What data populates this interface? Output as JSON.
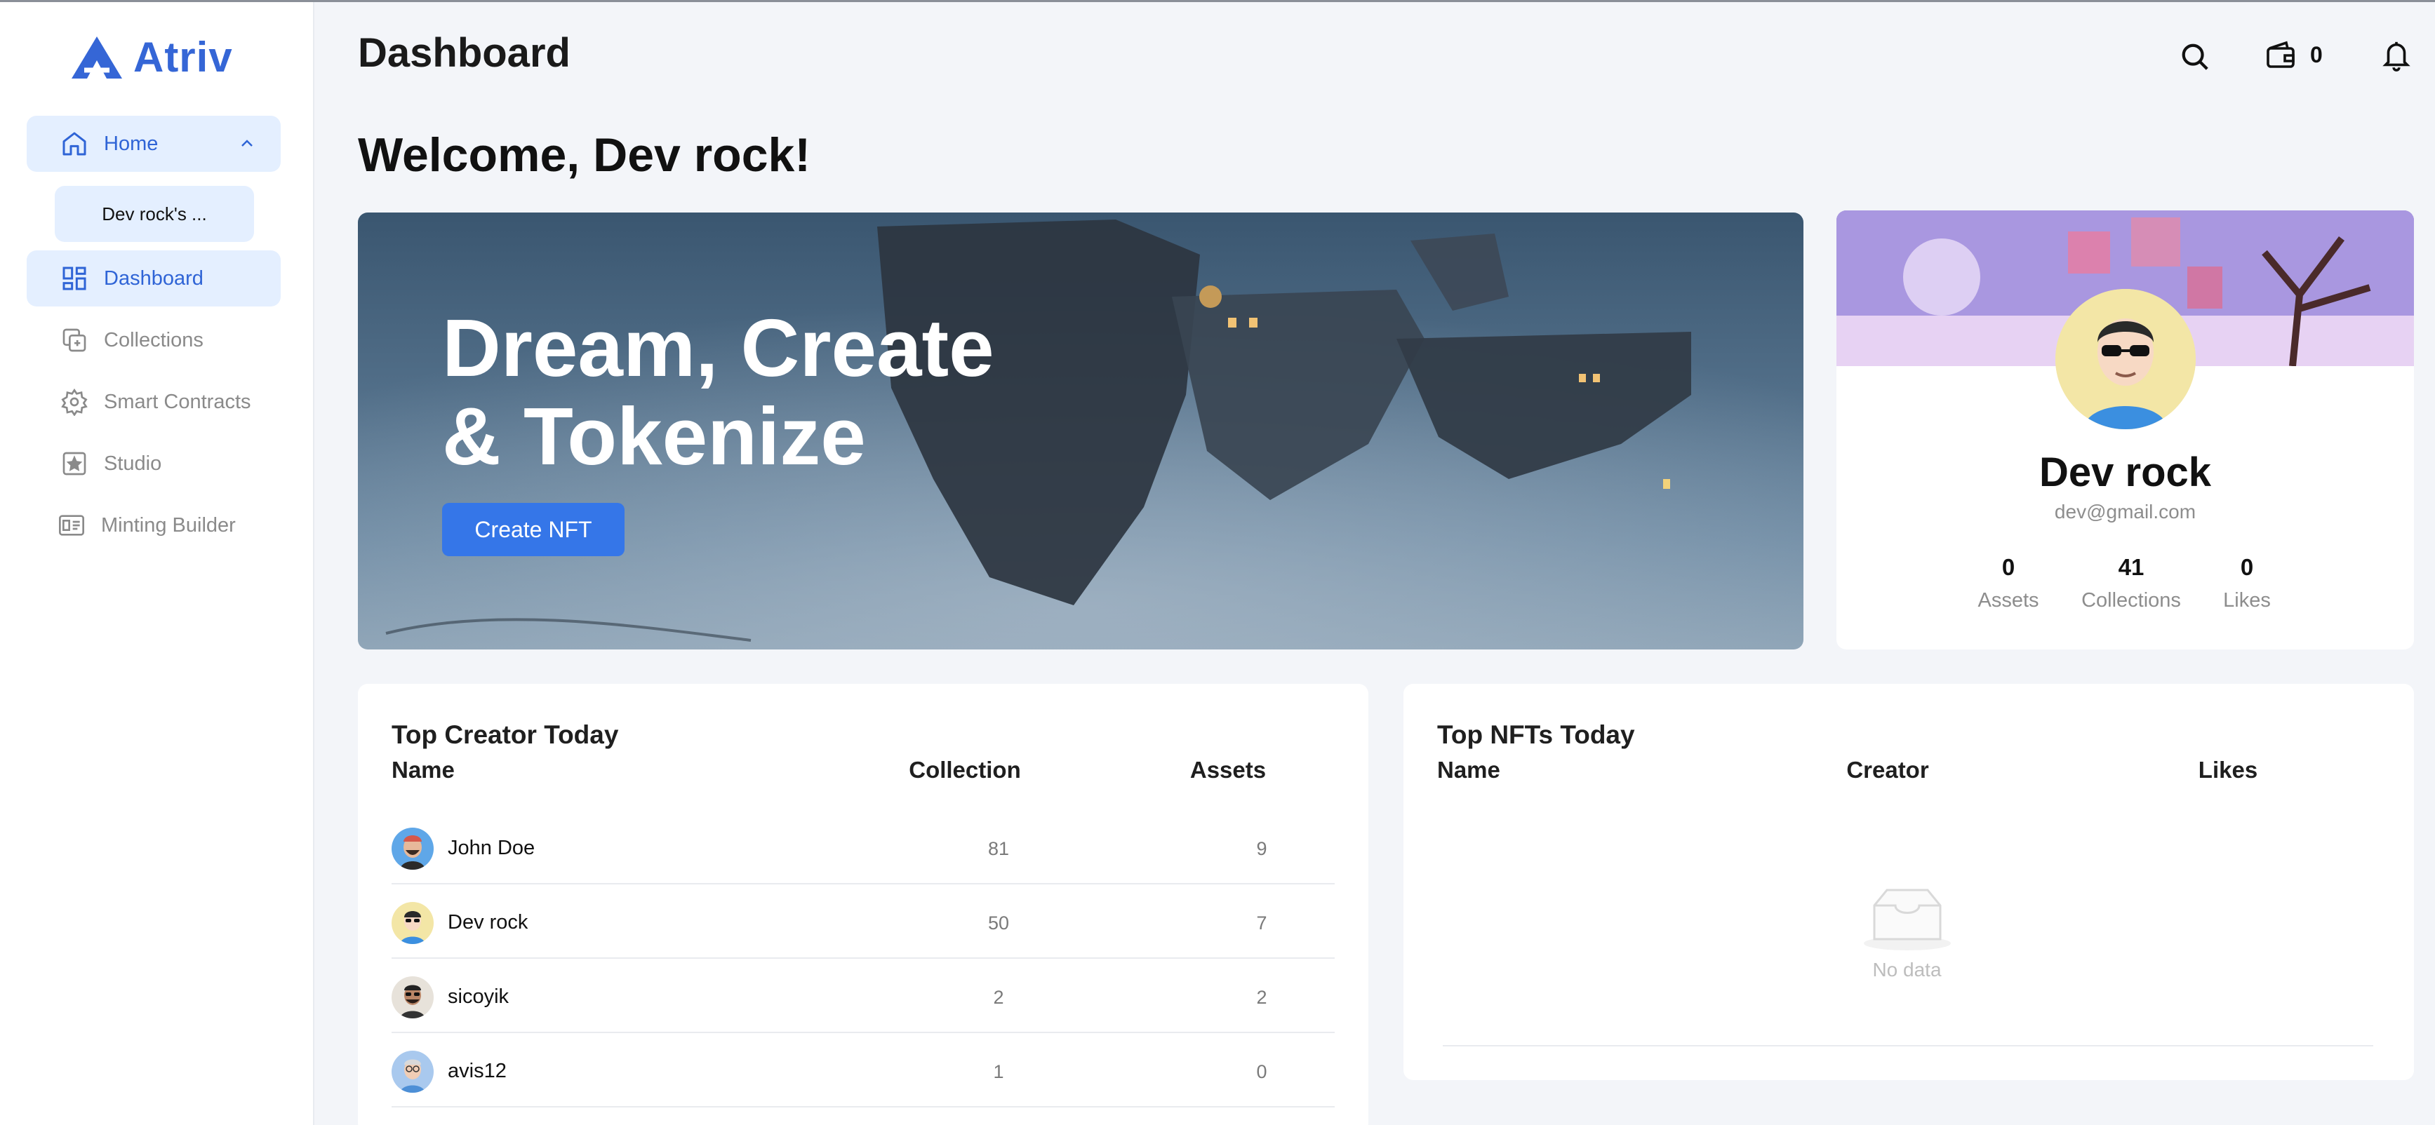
{
  "app": {
    "name": "Atriv"
  },
  "sidebar": {
    "home_label": "Home",
    "sub_item_label": "Dev rock's ...",
    "items": [
      {
        "label": "Dashboard",
        "icon": "dashboard-icon"
      },
      {
        "label": "Collections",
        "icon": "collections-icon"
      },
      {
        "label": "Smart Contracts",
        "icon": "gear-icon"
      },
      {
        "label": "Studio",
        "icon": "star-frame-icon"
      },
      {
        "label": "Minting Builder",
        "icon": "builder-icon"
      }
    ]
  },
  "header": {
    "title": "Dashboard",
    "wallet_count": "0"
  },
  "welcome": "Welcome, Dev rock!",
  "hero": {
    "title": "Dream, Create & Tokenize",
    "button": "Create NFT"
  },
  "profile": {
    "name": "Dev rock",
    "email": "dev@gmail.com",
    "stats": [
      {
        "value": "0",
        "label": "Assets"
      },
      {
        "value": "41",
        "label": "Collections"
      },
      {
        "value": "0",
        "label": "Likes"
      }
    ]
  },
  "top_creators": {
    "title": "Top Creator Today",
    "columns": [
      "Name",
      "Collection",
      "Assets"
    ],
    "rows": [
      {
        "name": "John Doe",
        "collection": "81",
        "assets": "9"
      },
      {
        "name": "Dev rock",
        "collection": "50",
        "assets": "7"
      },
      {
        "name": "sicoyik",
        "collection": "2",
        "assets": "2"
      },
      {
        "name": "avis12",
        "collection": "1",
        "assets": "0"
      }
    ]
  },
  "top_nfts": {
    "title": "Top NFTs Today",
    "columns": [
      "Name",
      "Creator",
      "Likes"
    ],
    "empty_text": "No data"
  },
  "colors": {
    "accent": "#3566d6",
    "active_bg": "#e4efff",
    "button": "#3576e8"
  }
}
